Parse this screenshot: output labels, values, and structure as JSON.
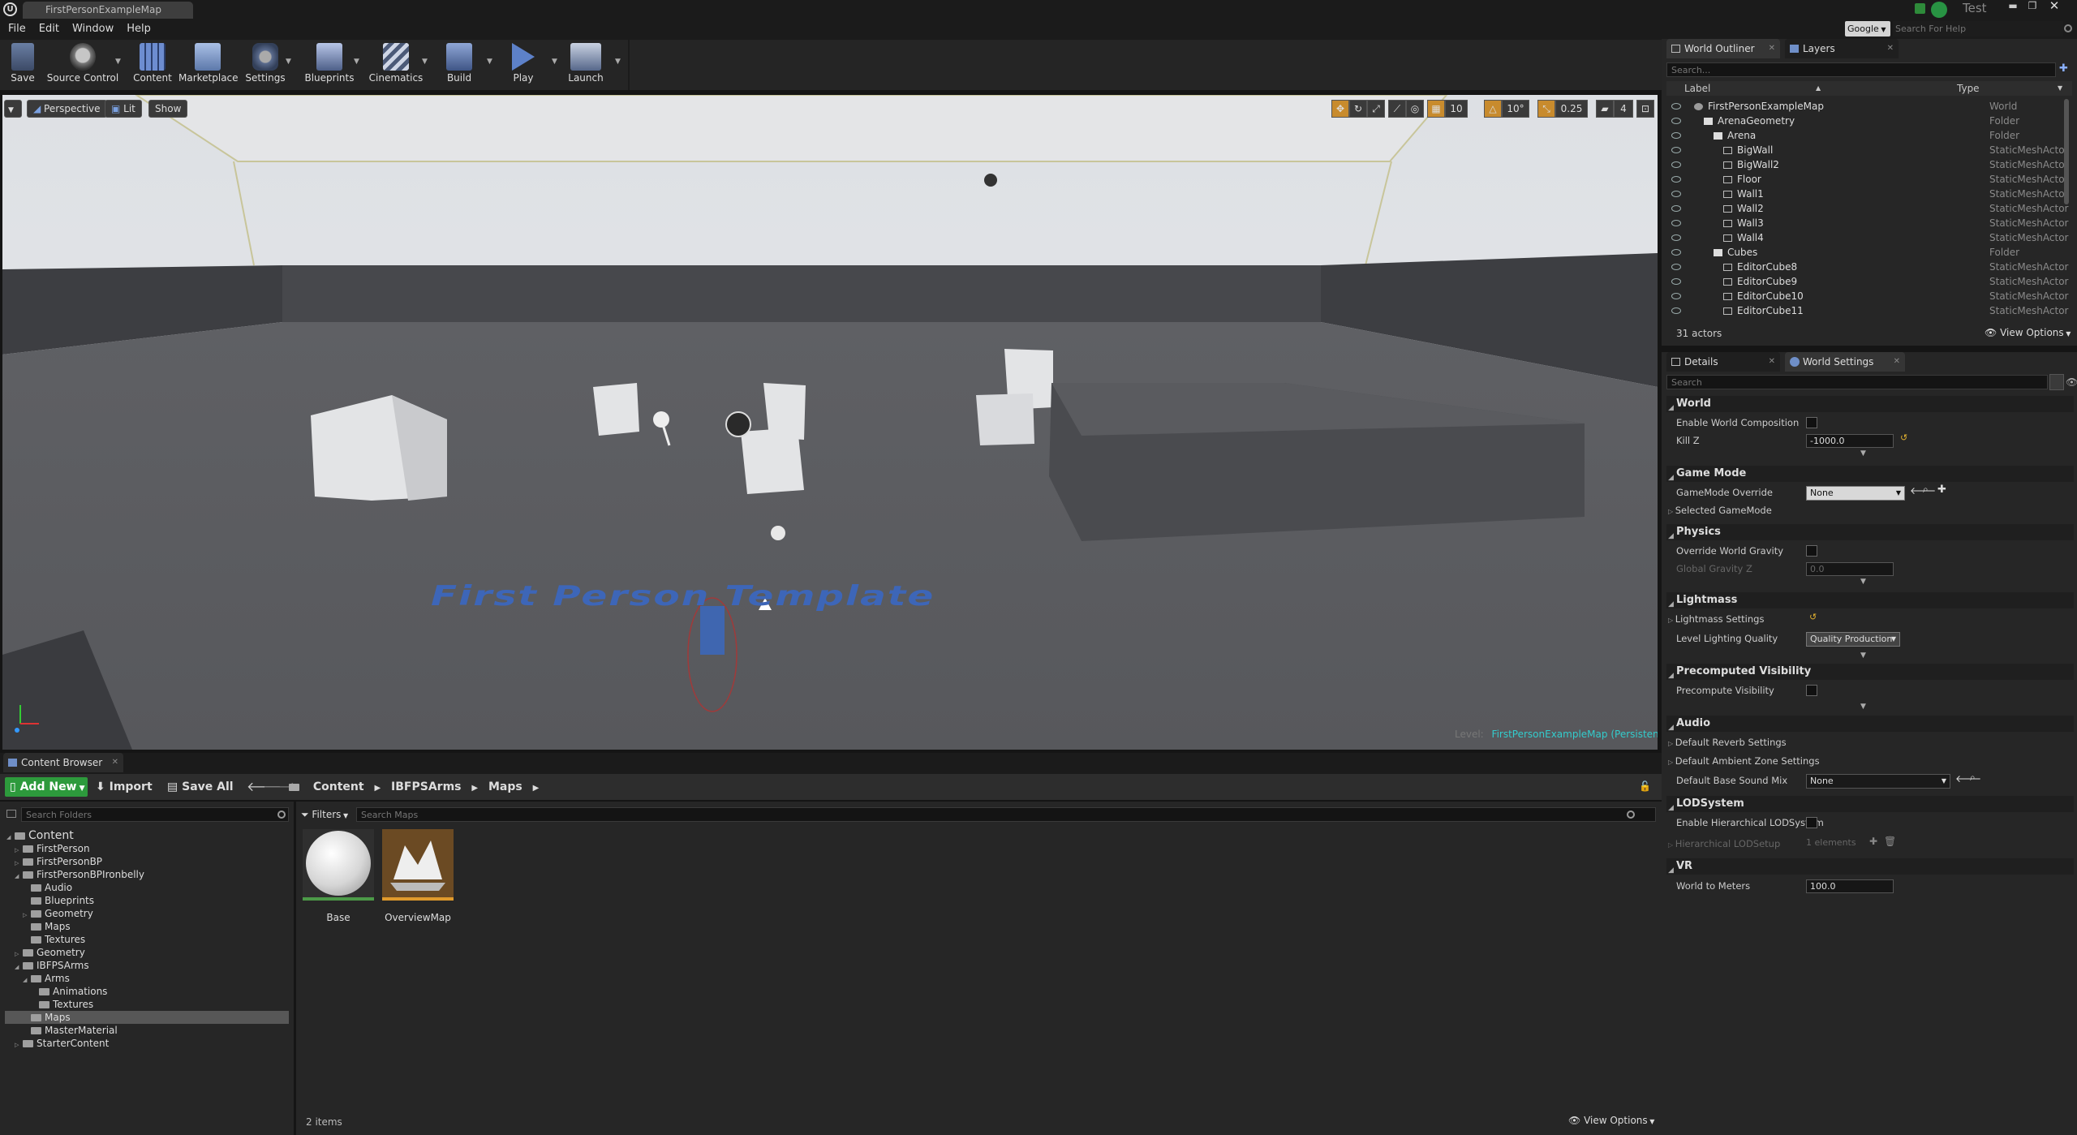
{
  "window": {
    "tab_title": "FirstPersonExampleMap",
    "project_name": "Test",
    "help_search_engine": "Google",
    "help_search_placeholder": "Search For Help"
  },
  "menu": [
    "File",
    "Edit",
    "Window",
    "Help"
  ],
  "toolbar": [
    {
      "label": "Save",
      "icon": "save-icon"
    },
    {
      "label": "Source Control",
      "icon": "source-control-icon"
    },
    {
      "label": "Content",
      "icon": "content-icon"
    },
    {
      "label": "Marketplace",
      "icon": "marketplace-icon"
    },
    {
      "label": "Settings",
      "icon": "settings-icon"
    },
    {
      "label": "Blueprints",
      "icon": "blueprints-icon"
    },
    {
      "label": "Cinematics",
      "icon": "cinematics-icon"
    },
    {
      "label": "Build",
      "icon": "build-icon"
    },
    {
      "label": "Play",
      "icon": "play-icon"
    },
    {
      "label": "Launch",
      "icon": "launch-icon"
    }
  ],
  "viewport": {
    "view_mode": "Perspective",
    "lighting": "Lit",
    "show": "Show",
    "grid_snap": "10",
    "rotation_snap": "10°",
    "scale_snap": "0.25",
    "camera_speed": "4",
    "floor_text": "First Person Template",
    "level_label": "Level:",
    "level_name": "FirstPersonExampleMap (Persistent)"
  },
  "content_browser": {
    "tab": "Content Browser",
    "add_new": "Add New",
    "import": "Import",
    "save_all": "Save All",
    "breadcrumb": [
      "Content",
      "IBFPSArms",
      "Maps"
    ],
    "search_folders_placeholder": "Search Folders",
    "filters": "Filters",
    "search_placeholder": "Search Maps",
    "folders": [
      {
        "label": "Content",
        "depth": 0
      },
      {
        "label": "FirstPerson",
        "depth": 1
      },
      {
        "label": "FirstPersonBP",
        "depth": 1
      },
      {
        "label": "FirstPersonBPIronbelly",
        "depth": 1
      },
      {
        "label": "Audio",
        "depth": 2
      },
      {
        "label": "Blueprints",
        "depth": 2
      },
      {
        "label": "Geometry",
        "depth": 2
      },
      {
        "label": "Maps",
        "depth": 2
      },
      {
        "label": "Textures",
        "depth": 2
      },
      {
        "label": "Geometry",
        "depth": 1
      },
      {
        "label": "IBFPSArms",
        "depth": 1
      },
      {
        "label": "Arms",
        "depth": 2
      },
      {
        "label": "Animations",
        "depth": 3
      },
      {
        "label": "Textures",
        "depth": 3
      },
      {
        "label": "Maps",
        "depth": 2
      },
      {
        "label": "MasterMaterial",
        "depth": 2
      },
      {
        "label": "StarterContent",
        "depth": 1
      }
    ],
    "assets": [
      {
        "name": "Base"
      },
      {
        "name": "OverviewMap"
      }
    ],
    "item_count": "2 items",
    "view_options": "View Options"
  },
  "world_outliner": {
    "tabs": [
      "World Outliner",
      "Layers"
    ],
    "search_placeholder": "Search...",
    "columns": [
      "Label",
      "Type"
    ],
    "rows": [
      {
        "label": "FirstPersonExampleMap",
        "type": "World",
        "depth": 0
      },
      {
        "label": "ArenaGeometry",
        "type": "Folder",
        "depth": 1
      },
      {
        "label": "Arena",
        "type": "Folder",
        "depth": 2
      },
      {
        "label": "BigWall",
        "type": "StaticMeshActor",
        "depth": 3
      },
      {
        "label": "BigWall2",
        "type": "StaticMeshActor",
        "depth": 3
      },
      {
        "label": "Floor",
        "type": "StaticMeshActor",
        "depth": 3
      },
      {
        "label": "Wall1",
        "type": "StaticMeshActor",
        "depth": 3
      },
      {
        "label": "Wall2",
        "type": "StaticMeshActor",
        "depth": 3
      },
      {
        "label": "Wall3",
        "type": "StaticMeshActor",
        "depth": 3
      },
      {
        "label": "Wall4",
        "type": "StaticMeshActor",
        "depth": 3
      },
      {
        "label": "Cubes",
        "type": "Folder",
        "depth": 2
      },
      {
        "label": "EditorCube8",
        "type": "StaticMeshActor",
        "depth": 3
      },
      {
        "label": "EditorCube9",
        "type": "StaticMeshActor",
        "depth": 3
      },
      {
        "label": "EditorCube10",
        "type": "StaticMeshActor",
        "depth": 3
      },
      {
        "label": "EditorCube11",
        "type": "StaticMeshActor",
        "depth": 3
      }
    ],
    "actor_count": "31 actors",
    "view_options": "View Options"
  },
  "details": {
    "tabs": [
      "Details",
      "World Settings"
    ],
    "search_placeholder": "Search",
    "world": {
      "title": "World",
      "enable_world_composition": "Enable World Composition",
      "kill_z_label": "Kill Z",
      "kill_z": "-1000.0"
    },
    "game_mode": {
      "title": "Game Mode",
      "override_label": "GameMode Override",
      "override_value": "None",
      "selected_label": "Selected GameMode"
    },
    "physics": {
      "title": "Physics",
      "override_gravity": "Override World Gravity",
      "gravity_label": "Global Gravity Z",
      "gravity_value": "0.0"
    },
    "lightmass": {
      "title": "Lightmass",
      "settings": "Lightmass Settings",
      "quality_label": "Level Lighting Quality",
      "quality_value": "Quality Production"
    },
    "precomputed": {
      "title": "Precomputed Visibility",
      "precompute": "Precompute Visibility"
    },
    "audio": {
      "title": "Audio",
      "reverb": "Default Reverb Settings",
      "ambient": "Default Ambient Zone Settings",
      "sound_mix_label": "Default Base Sound Mix",
      "sound_mix_value": "None"
    },
    "lod": {
      "title": "LODSystem",
      "enable_hlod": "Enable Hierarchical LODSystem",
      "hlod_setup": "Hierarchical LODSetup",
      "elements": "1 elements"
    },
    "vr": {
      "title": "VR",
      "world_to_meters_label": "World to Meters",
      "world_to_meters": "100.0"
    }
  }
}
